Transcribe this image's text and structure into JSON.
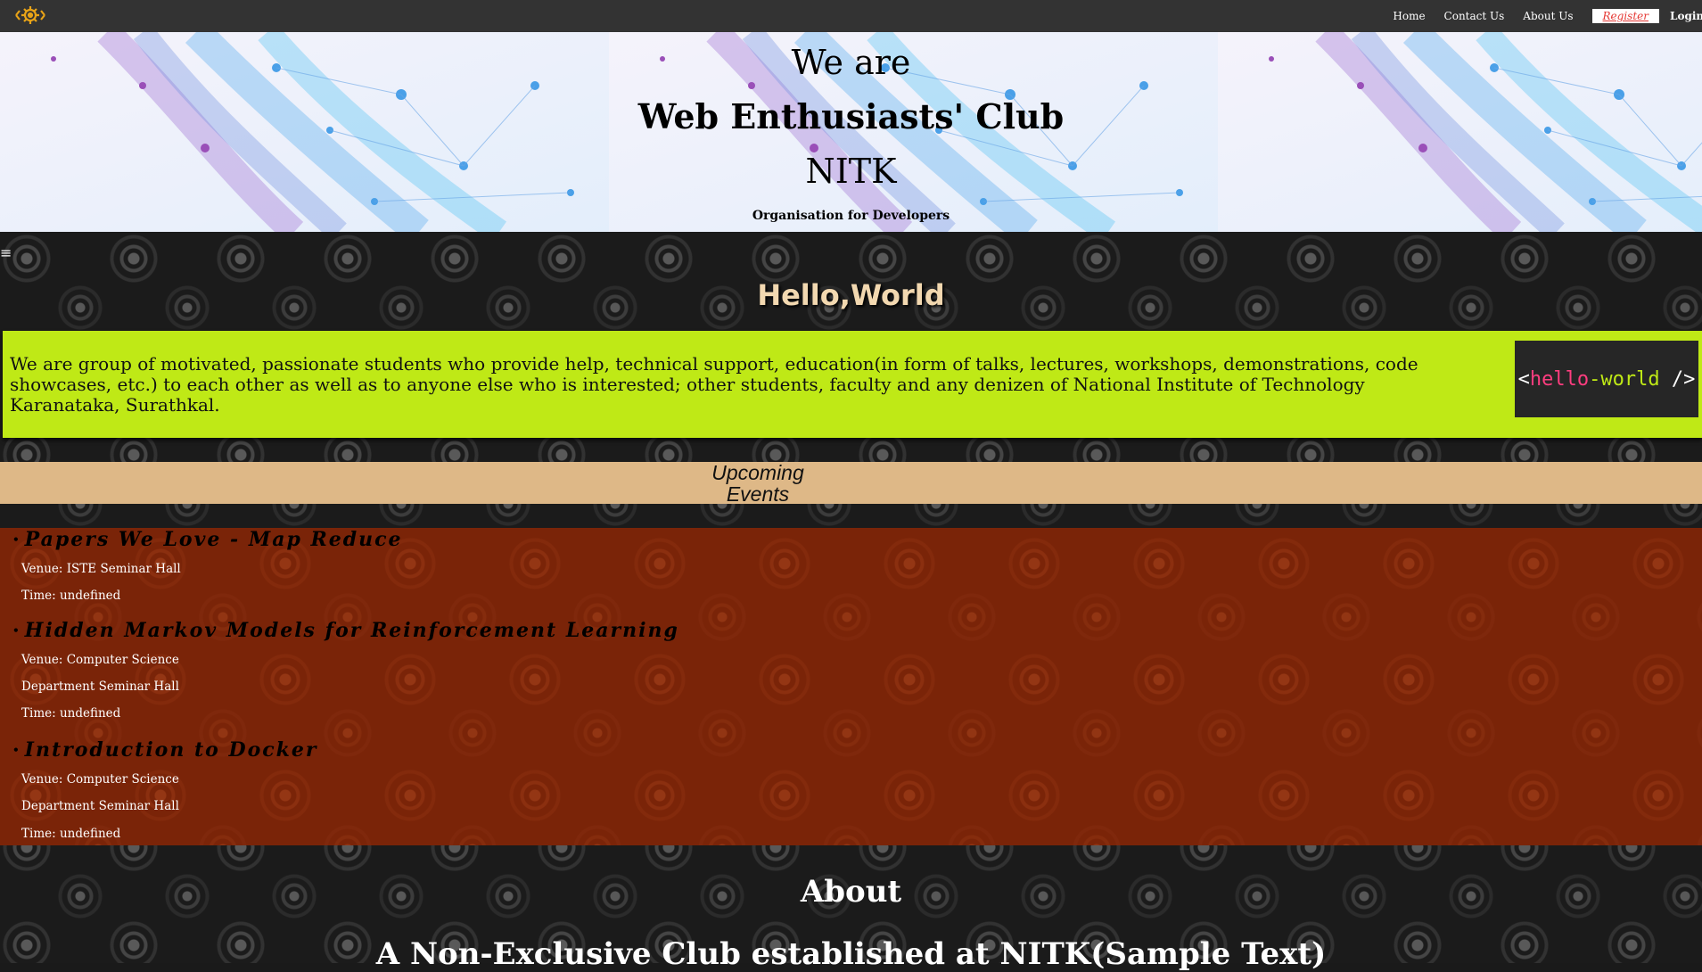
{
  "nav": {
    "logo_icon": "gear-logo-icon",
    "links": [
      "Home",
      "Contact Us",
      "About Us"
    ],
    "register": "Register",
    "login": "Login"
  },
  "hero": {
    "line1": "We are",
    "line2": "Web Enthusiasts' Club",
    "line3": "NITK",
    "tagline": "Organisation for Developers"
  },
  "menu_icon": "≡",
  "greeting": "Hello,World",
  "intro": {
    "text": "We are group of motivated, passionate students who provide help, technical support, education(in form of talks, lectures, workshops, demonstrations, code showcases, etc.) to each other as well as to anyone else who is interested; other students, faculty and any denizen of National Institute of Technology Karanataka, Surathkal.",
    "code_open": "<",
    "code_hello": "hello",
    "code_dash": "-",
    "code_world": "world",
    "code_close": " />"
  },
  "upcoming": {
    "title": "Upcoming Events"
  },
  "events": [
    {
      "title": "Papers We Love - Map Reduce",
      "venue": "Venue: ISTE Seminar Hall",
      "time": "Time: undefined"
    },
    {
      "title": "Hidden Markov Models for Reinforcement Learning",
      "venue_line1": "Venue: Computer Science",
      "venue_line2": "Department Seminar Hall",
      "time": "Time: undefined"
    },
    {
      "title": "Introduction to Docker",
      "venue_line1": "Venue: Computer Science",
      "venue_line2": "Department Seminar Hall",
      "time": "Time: undefined"
    }
  ],
  "about": {
    "title": "About",
    "subtitle": "A Non-Exclusive Club established at NITK(Sample Text)"
  },
  "colors": {
    "nav_bg": "#333333",
    "intro_bg": "#bfe916",
    "upcoming_bg": "#deb887",
    "events_bg": "#7a2408",
    "register_text": "#e53935"
  }
}
